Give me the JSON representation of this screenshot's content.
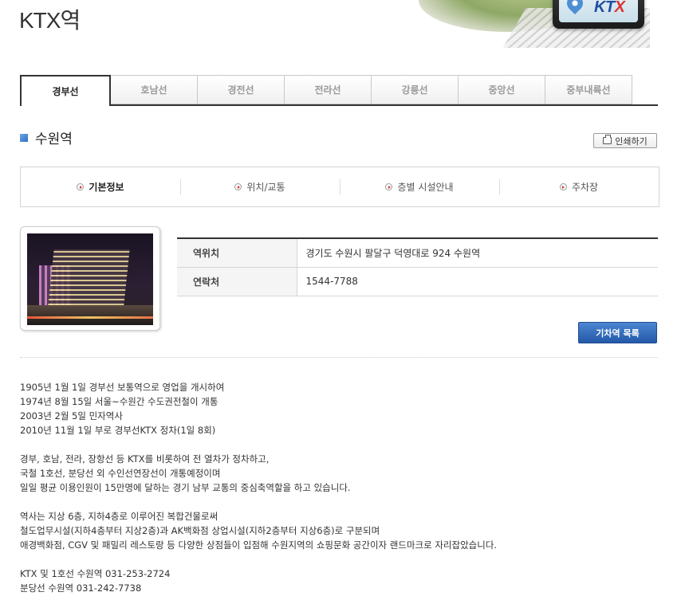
{
  "page": {
    "title": "KTX역"
  },
  "banner": {
    "logo_main": "KT",
    "logo_x": "X"
  },
  "line_tabs": [
    {
      "label": "경부선",
      "active": true
    },
    {
      "label": "호남선",
      "active": false
    },
    {
      "label": "경전선",
      "active": false
    },
    {
      "label": "전라선",
      "active": false
    },
    {
      "label": "강릉선",
      "active": false
    },
    {
      "label": "중앙선",
      "active": false
    },
    {
      "label": "중부내륙선",
      "active": false
    }
  ],
  "station": {
    "name": "수원역",
    "print_label": "인쇄하기"
  },
  "sub_tabs": [
    {
      "label": "기본정보",
      "active": true
    },
    {
      "label": "위치/교통",
      "active": false
    },
    {
      "label": "층별 시설안내",
      "active": false
    },
    {
      "label": "주차장",
      "active": false
    }
  ],
  "info": [
    {
      "label": "역위치",
      "value": "경기도 수원시 팔달구 덕영대로 924 수원역"
    },
    {
      "label": "연락처",
      "value": "1544-7788"
    }
  ],
  "list_button_label": "기차역 목록",
  "description": [
    [
      "1905년 1월 1일 경부선 보통역으로 영업을 개시하여",
      "1974년 8월 15일 서울~수원간 수도권전철이 개통",
      "2003년 2월 5일 민자역사",
      "2010년 11월 1일 부로 경부선KTX 정차(1일 8회)"
    ],
    [
      "경부, 호남, 전라, 장항선 등 KTX를 비롯하여 전 열차가 정차하고,",
      "국철 1호선, 분당선 외 수인선연장선이 개통예정이며",
      "일일 평균 이용인원이 15만명에 달하는 경기 남부 교통의 중심축역할을 하고 있습니다."
    ],
    [
      "역사는 지상 6층, 지하4층로 이루어진 복합건물로써",
      "철도업무시설(지하4층부터 지상2층)과 AK백화점 상업시설(지하2층부터 지상6층)로 구분되며",
      "애경백화점, CGV 및 패밀리 레스토랑 등 다양한 상점들이 입점해 수원지역의 쇼핑문화 공간이자 랜드마크로 자리잡았습니다."
    ],
    [
      "KTX 및 1호선 수원역 031-253-2724",
      "분당선 수원역 031-242-7738"
    ]
  ]
}
